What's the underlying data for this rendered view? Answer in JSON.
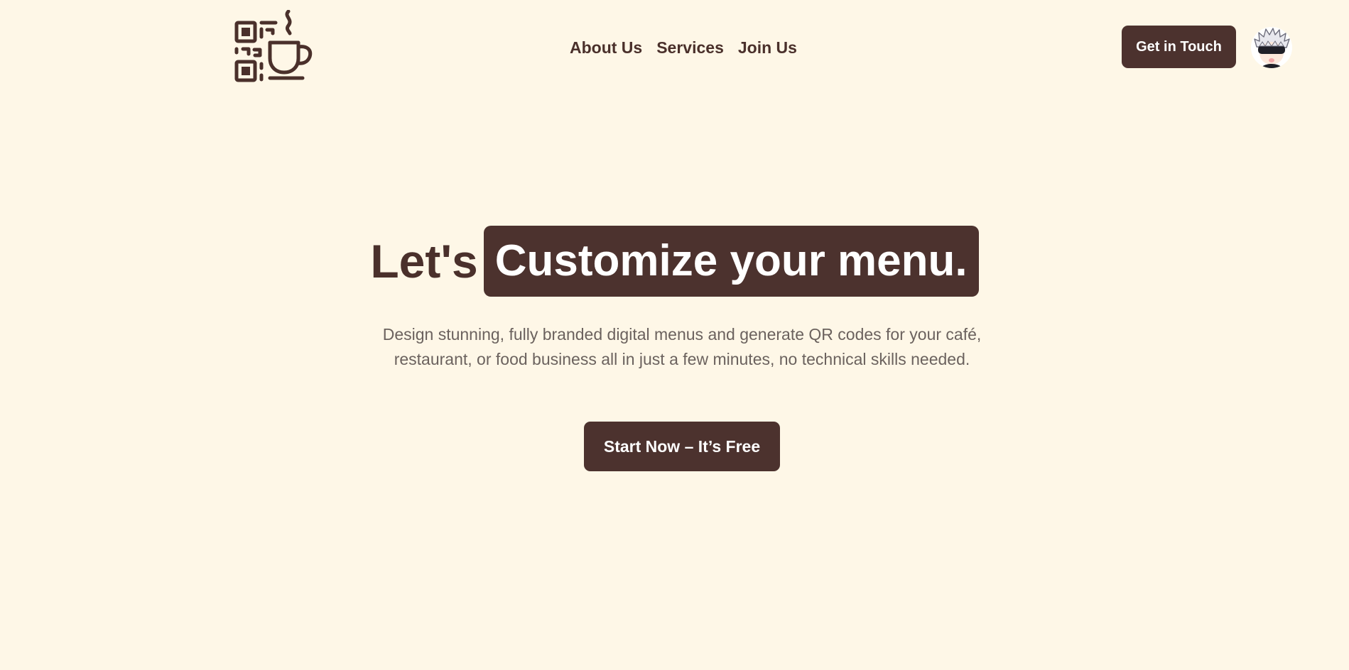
{
  "header": {
    "logo_icon": "qr-code-coffee-cup-icon",
    "nav": [
      {
        "label": "About Us"
      },
      {
        "label": "Services"
      },
      {
        "label": "Join Us"
      }
    ],
    "cta_label": "Get in Touch",
    "avatar_icon": "user-avatar-icon"
  },
  "hero": {
    "title_plain": "Let's",
    "title_highlight": "Customize your menu.",
    "subtitle": "Design stunning, fully branded digital menus and generate QR codes for your café, restaurant, or food business all in just a few minutes, no technical skills needed.",
    "cta_label": "Start Now – It’s Free"
  },
  "colors": {
    "background": "#FEF7E7",
    "brand_brown": "#4C322E",
    "text_dark": "#4A302B",
    "text_muted": "#6B625E",
    "on_brand": "#FFFFFF"
  }
}
